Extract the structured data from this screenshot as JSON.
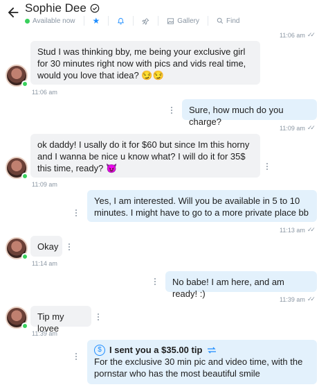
{
  "header": {
    "contact_name": "Sophie Dee",
    "status": "Available now",
    "gallery_label": "Gallery",
    "find_label": "Find"
  },
  "messages": [
    {
      "time": "11:06 am"
    },
    {
      "text": "Stud I was thinking bby, me being your exclusive girl for 30 minutes right now with pics and vids real time, would you love that idea? 😏😏",
      "time": "11:06 am"
    },
    {
      "text": "Sure, how much do you charge?",
      "time": "11:09 am"
    },
    {
      "text": "ok daddy! I usally do it for $60 but since Im this horny and I wanna be nice u know what? I will do it for 35$ this time, ready? 😈",
      "time": "11:09 am"
    },
    {
      "text": "Yes, I am interested. Will you be available in 5 to 10 minutes. I might have to go to a more private place bb",
      "time": "11:13 am"
    },
    {
      "text": "Okay",
      "time": "11:14 am"
    },
    {
      "text": "No babe! I am here, and am ready! :)",
      "time": "11:39 am"
    },
    {
      "text": "Tip my lovee",
      "time": "11:39 am"
    }
  ],
  "tip": {
    "title": "I sent you a $35.00 tip",
    "message": "For the exclusive 30 min pic and video time, with the pornstar who has the most beautiful smile"
  },
  "colors": {
    "accent": "#1e8dff",
    "online": "#39d05c",
    "incoming_bg": "#f1f2f4",
    "outgoing_bg": "#e3f1fc"
  }
}
